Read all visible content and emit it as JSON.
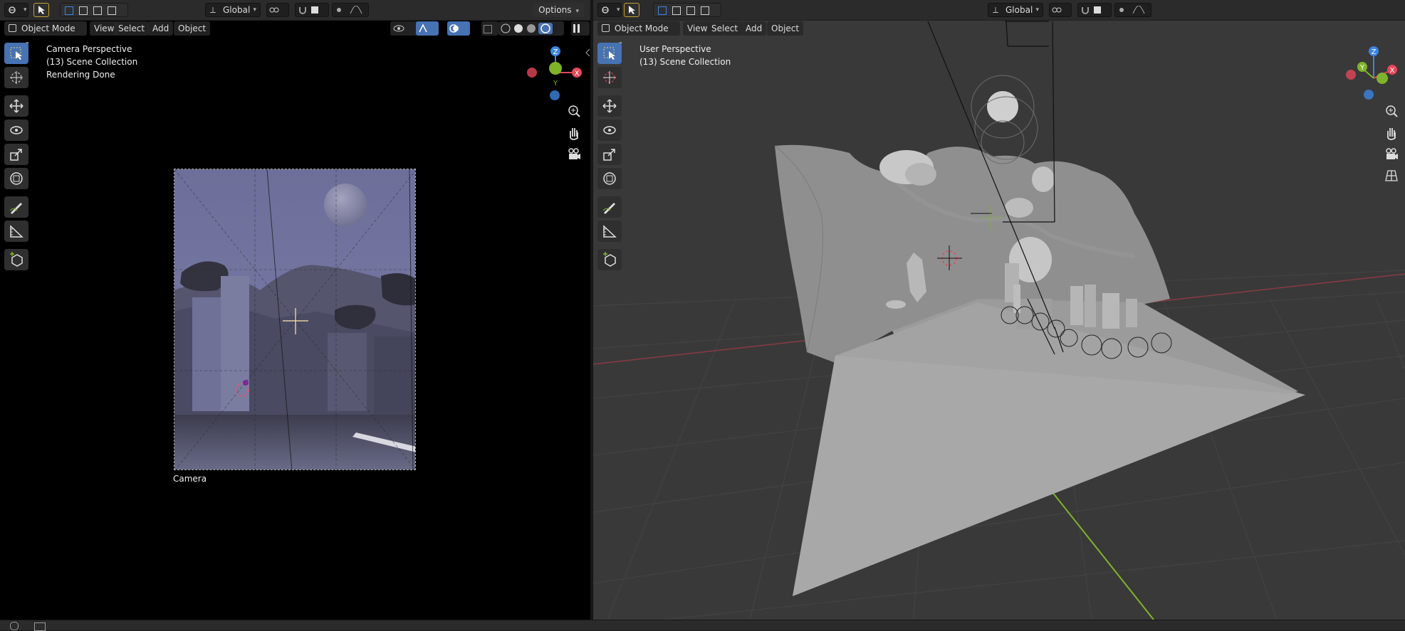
{
  "left_viewport": {
    "header": {
      "transform_orientation": "Global",
      "options_label": "Options"
    },
    "view_header": {
      "mode": "Object Mode",
      "menus": [
        "View",
        "Select",
        "Add",
        "Object"
      ]
    },
    "overlay_text": {
      "perspective": "Camera Perspective",
      "collection": "(13) Scene Collection",
      "status": "Rendering Done"
    },
    "camera_label": "Camera"
  },
  "right_viewport": {
    "header": {
      "transform_orientation": "Global"
    },
    "view_header": {
      "mode": "Object Mode",
      "menus": [
        "View",
        "Select",
        "Add",
        "Object"
      ]
    },
    "overlay_text": {
      "perspective": "User Perspective",
      "collection": "(13) Scene Collection"
    }
  },
  "gizmo_axes": {
    "z": "Z",
    "y": "Y",
    "x": "X"
  },
  "colors": {
    "x_axis": "#e5475a",
    "y_axis": "#7fb42a",
    "z_axis": "#3b84e0",
    "active": "#4772b3"
  },
  "toolbar_icons": [
    "select-box-icon",
    "cursor-icon",
    "move-icon",
    "rotate-icon",
    "scale-icon",
    "transform-icon",
    "annotate-icon",
    "measure-icon",
    "add-cube-icon"
  ]
}
